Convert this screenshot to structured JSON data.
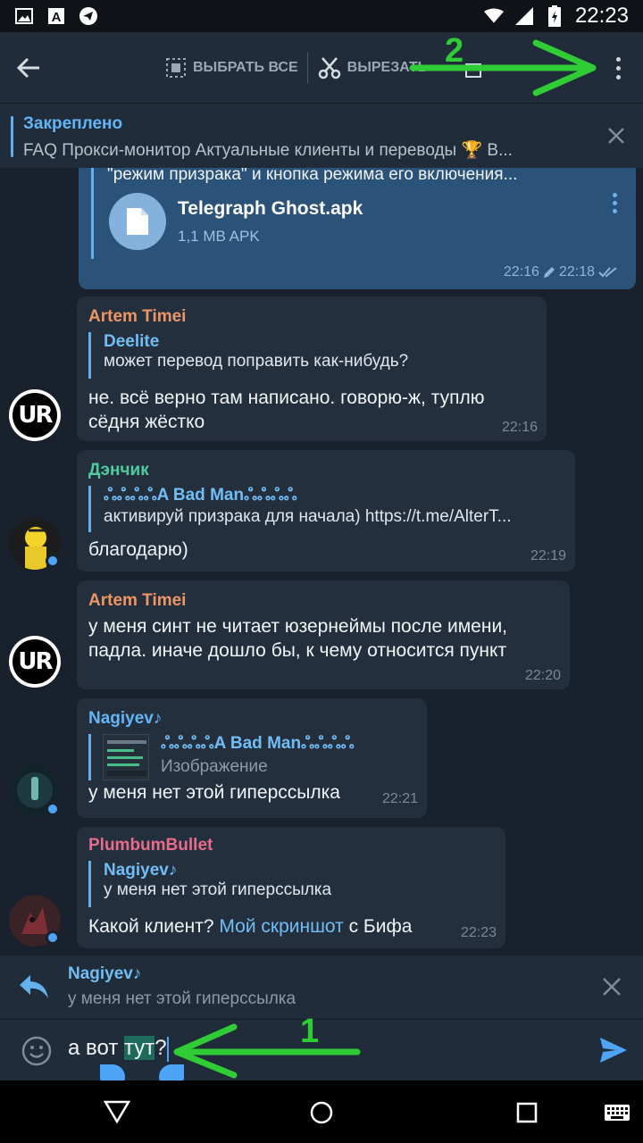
{
  "status": {
    "time": "22:23"
  },
  "toolbar": {
    "select_all": "ВЫБРАТЬ ВСЕ",
    "cut": "ВЫРЕЗАТЬ"
  },
  "pinned": {
    "title": "Закреплено",
    "text": "FAQ  Прокси-монитор  Актуальные клиенты и переводы 🏆 В..."
  },
  "messages": {
    "m0": {
      "text": "\"режим призрака\" и кнопка режима его включения...",
      "file_name": "Telegraph Ghost.apk",
      "file_size": "1,1 MB APK",
      "time": "22:16",
      "edited_time": "22:18"
    },
    "m1": {
      "sender": "Artem Timei",
      "sender_color": "#ee9565",
      "quote_name": "Deelite",
      "quote_text": "может перевод поправить как-нибудь?",
      "text": "не. всё верно там написано. говорю-ж, туплю сёдня жёстко",
      "time": "22:16"
    },
    "m2": {
      "sender": "Дэнчик",
      "sender_color": "#4dcca0",
      "quote_name": "ஃஃஃஃA Bad Manஃஃஃஃ",
      "quote_text": "активируй призрака для начала) https://t.me/AlterT...",
      "text": "благодарю)",
      "time": "22:19"
    },
    "m3": {
      "sender": "Artem Timei",
      "sender_color": "#ee9565",
      "text": "у меня синт не читает юзернеймы после имени, падла. иначе дошло бы, к чему относится пункт",
      "time": "22:20"
    },
    "m4": {
      "sender": "Nagiyev♪",
      "sender_color": "#64b5f6",
      "quote_name": "ஃஃஃஃA Bad Manஃஃஃஃ",
      "quote_text": "Изображение",
      "text": "у меня нет этой гиперссылка",
      "time": "22:21"
    },
    "m5": {
      "sender": "PlumbumBullet",
      "sender_color": "#e86b8c",
      "quote_name": "Nagiyev♪",
      "quote_text": "у меня нет этой гиперссылка",
      "text_before": "Какой клиент? ",
      "link": "Мой скриншот",
      "text_after": " с Бифа",
      "time": "22:23"
    }
  },
  "reply": {
    "name": "Nagiyev♪",
    "text": "у меня нет этой гиперссылка"
  },
  "input": {
    "before": "а вот ",
    "selected": "тут",
    "after": "?"
  },
  "annotations": {
    "one": "1",
    "two": "2"
  },
  "colors": {
    "accent": "#4ea4f6",
    "bubble_in": "#232f3c",
    "bubble_out": "#2b5278",
    "annotation": "#2fcc35"
  }
}
